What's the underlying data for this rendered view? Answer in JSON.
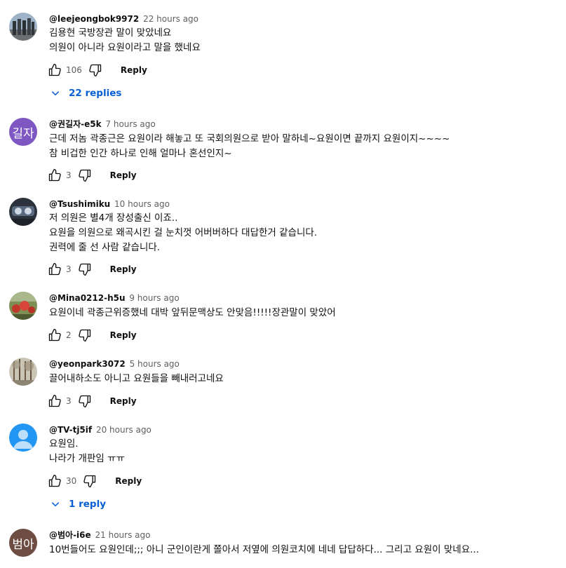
{
  "comments": [
    {
      "handle": "@leejeongbok9972",
      "time": "22 hours ago",
      "lines": [
        "김용현 국방장관 말이 맞았네요",
        "의원이 아니라 요원이라고 말을 했네요"
      ],
      "likes": "106",
      "reply": "Reply",
      "replies": "22 replies",
      "avatar": {
        "type": "photo-statues",
        "bg": "#8aa0b8"
      }
    },
    {
      "handle": "@권길자-e5k",
      "time": "7 hours ago",
      "lines": [
        "근데 저놈 곽종근은 요원이라 해놓고 또 국회의원으로 받아  말하네~요원이면 끝까지  요원이지~~~~",
        "참 비겁한 인간 하나로 인해 얼마나 혼선인지~"
      ],
      "likes": "3",
      "reply": "Reply",
      "avatar": {
        "type": "initials",
        "text": "길자",
        "bg": "#7e57c2"
      }
    },
    {
      "handle": "@Tsushimiku",
      "time": "10 hours ago",
      "lines": [
        "저 의원은 별4개 장성출신 이죠..",
        "요원을 의원으로 왜곡시킨 걸 눈치껏 어버버하다 대답한거 같습니다.",
        "권력에 줄 선 사람 같습니다."
      ],
      "likes": "3",
      "reply": "Reply",
      "avatar": {
        "type": "photo-dash",
        "bg": "#3a4150"
      }
    },
    {
      "handle": "@Mina0212-h5u",
      "time": "9 hours ago",
      "lines": [
        "요원이네  곽종근위증했네 대박 앞뒤문맥상도 안맞음!!!!!장관말이 맞았어"
      ],
      "likes": "2",
      "reply": "Reply",
      "avatar": {
        "type": "photo-flowers",
        "bg": "#6d7d4a"
      }
    },
    {
      "handle": "@yeonpark3072",
      "time": "5 hours ago",
      "lines": [
        "끌어내하소도 아니고 요원들을 빼내러고네요"
      ],
      "likes": "3",
      "reply": "Reply",
      "avatar": {
        "type": "photo-trees",
        "bg": "#b8b4a6"
      }
    },
    {
      "handle": "@TV-tj5if",
      "time": "20 hours ago",
      "lines": [
        "요원임.",
        "나라가 개판임 ㅠㅠ"
      ],
      "likes": "30",
      "reply": "Reply",
      "replies": "1 reply",
      "avatar": {
        "type": "default-person",
        "bg": "#2196f3"
      }
    },
    {
      "handle": "@범아-i6e",
      "time": "21 hours ago",
      "lines": [
        "10번들어도 요원인데;;;  아니 군인이란게 쫄아서 저옆에 의원코치에 네네 답답하다... 그리고 요원이 맞네요..."
      ],
      "likes": "",
      "reply": "",
      "avatar": {
        "type": "initials",
        "text": "범아",
        "bg": "#6d4c41"
      }
    }
  ]
}
